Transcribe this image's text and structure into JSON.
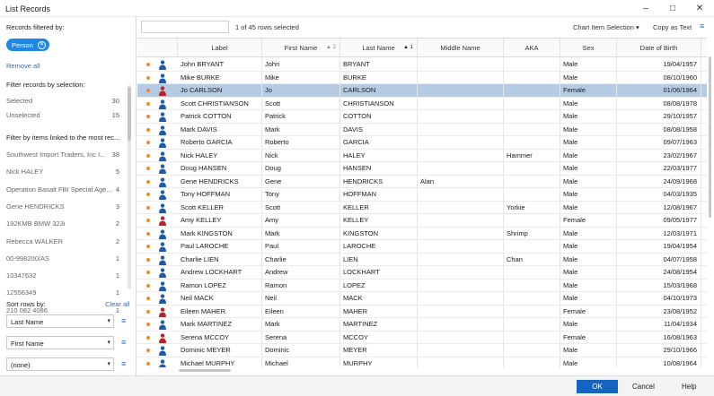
{
  "window": {
    "title": "List Records"
  },
  "left": {
    "filtered_label": "Records filtered by:",
    "chip_label": "Person",
    "remove_all": "Remove all",
    "filter_selection_heading": "Filter records by selection:",
    "selection": [
      {
        "label": "Selected",
        "count": "30"
      },
      {
        "label": "Unselected",
        "count": "15"
      }
    ],
    "linked_heading": "Filter by items linked to the most rec...",
    "linked": [
      {
        "label": "Southwest Import Traders, Inc I...",
        "count": "38"
      },
      {
        "label": "Nick HALEY",
        "count": "5"
      },
      {
        "label": "Operation Basalt FBI Special Age...",
        "count": "4"
      },
      {
        "label": "Gene  HENDRICKS",
        "count": "3"
      },
      {
        "label": "192KMB BMW 323i",
        "count": "2"
      },
      {
        "label": "Rebecca WALKER",
        "count": "2"
      },
      {
        "label": "00-998200/AS",
        "count": "1"
      },
      {
        "label": "10347632",
        "count": "1"
      },
      {
        "label": "12556349",
        "count": "1"
      },
      {
        "label": "210 082 4086",
        "count": "1"
      }
    ],
    "sort_label": "Sort rows by:",
    "clear_all": "Clear all",
    "sort_selects": [
      "Last Name",
      "First Name",
      "(none)"
    ]
  },
  "toolbar": {
    "rows_selected": "1 of 45 rows selected",
    "chart_item_selection": "Chart Item Selection",
    "copy_as_text": "Copy as Text"
  },
  "table": {
    "headers": [
      "Label",
      "First Name",
      "Last Name",
      "Middle Name",
      "AKA",
      "Sex",
      "Date of Birth"
    ],
    "sort_badges": [
      "2",
      "1"
    ],
    "rows": [
      [
        "John BRYANT",
        "John",
        "BRYANT",
        "",
        "",
        "Male",
        "19/04/1957"
      ],
      [
        "Mike BURKE",
        "Mike",
        "BURKE",
        "",
        "",
        "Male",
        "08/10/1960"
      ],
      [
        "Jo CARLSON",
        "Jo",
        "CARLSON",
        "",
        "",
        "Female",
        "01/06/1964"
      ],
      [
        "Scott CHRISTIANSON",
        "Scott",
        "CHRISTIANSON",
        "",
        "",
        "Male",
        "08/08/1978"
      ],
      [
        "Patrick COTTON",
        "Patrick",
        "COTTON",
        "",
        "",
        "Male",
        "29/10/1957"
      ],
      [
        "Mark DAVIS",
        "Mark",
        "DAVIS",
        "",
        "",
        "Male",
        "08/08/1958"
      ],
      [
        "Roberto GARCIA",
        "Roberto",
        "GARCIA",
        "",
        "",
        "Male",
        "09/07/1963"
      ],
      [
        "Nick HALEY",
        "Nick",
        "HALEY",
        "",
        "Hammer",
        "Male",
        "23/02/1967"
      ],
      [
        "Doug HANSEN",
        "Doug",
        "HANSEN",
        "",
        "",
        "Male",
        "22/03/1977"
      ],
      [
        "Gene  HENDRICKS",
        "Gene",
        "HENDRICKS",
        "Alan",
        "",
        "Male",
        "24/09/1968"
      ],
      [
        "Tony HOFFMAN",
        "Tony",
        "HOFFMAN",
        "",
        "",
        "Male",
        "04/03/1935"
      ],
      [
        "Scott KELLER",
        "Scott",
        "KELLER",
        "",
        "Yorkie",
        "Male",
        "12/08/1967"
      ],
      [
        "Amy KELLEY",
        "Amy",
        "KELLEY",
        "",
        "",
        "Female",
        "09/05/1977"
      ],
      [
        "Mark KINGSTON",
        "Mark",
        "KINGSTON",
        "",
        "Shrimp",
        "Male",
        "12/03/1971"
      ],
      [
        "Paul LAROCHE",
        "Paul",
        "LAROCHE",
        "",
        "",
        "Male",
        "19/04/1954"
      ],
      [
        "Charlie LIEN",
        "Charlie",
        "LIEN",
        "",
        "Chan",
        "Male",
        "04/07/1958"
      ],
      [
        "Andrew LOCKHART",
        "Andrew",
        "LOCKHART",
        "",
        "",
        "Male",
        "24/08/1954"
      ],
      [
        "Ramon LOPEZ",
        "Ramon",
        "LOPEZ",
        "",
        "",
        "Male",
        "15/03/1968"
      ],
      [
        "Neil MACK",
        "Neil",
        "MACK",
        "",
        "",
        "Male",
        "04/10/1973"
      ],
      [
        "Eileen MAHER",
        "Eileen",
        "MAHER",
        "",
        "",
        "Female",
        "23/08/1952"
      ],
      [
        "Mark MARTINEZ",
        "Mark",
        "MARTINEZ",
        "",
        "",
        "Male",
        "11/04/1934"
      ],
      [
        "Serena MCCOY",
        "Serena",
        "MCCOY",
        "",
        "",
        "Female",
        "16/08/1963"
      ],
      [
        "Dominic MEYER",
        "Dominic",
        "MEYER",
        "",
        "",
        "Male",
        "29/10/1966"
      ],
      [
        "Michael MURPHY",
        "Michael",
        "MURPHY",
        "",
        "",
        "Male",
        "10/08/1964"
      ]
    ],
    "selected_row_index": 2,
    "colors": {
      "male_icon": "#1e5aa8",
      "female_icon": "#b8232b",
      "flag_dot": "#f08a24",
      "selected_row": "#b4cbe3"
    }
  },
  "footer": {
    "ok": "OK",
    "cancel": "Cancel",
    "help": "Help"
  }
}
